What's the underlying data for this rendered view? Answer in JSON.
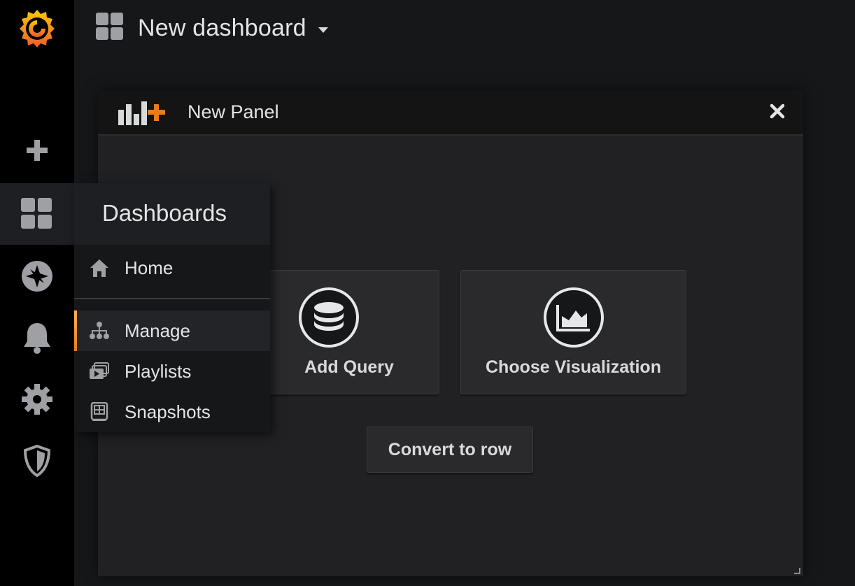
{
  "topbar": {
    "title": "New dashboard"
  },
  "panel": {
    "title": "New Panel",
    "actions": {
      "add_query_label": "Add Query",
      "choose_viz_label": "Choose Visualization",
      "convert_label": "Convert to row"
    }
  },
  "sidebar": {
    "items": [
      {
        "icon": "grafana-logo-icon"
      },
      {
        "icon": "plus-icon"
      },
      {
        "icon": "dashboards-grid-icon",
        "active": true
      },
      {
        "icon": "explore-compass-icon"
      },
      {
        "icon": "bell-icon"
      },
      {
        "icon": "gear-icon"
      },
      {
        "icon": "shield-icon"
      }
    ]
  },
  "dashboards_menu": {
    "header": "Dashboards",
    "items": [
      {
        "label": "Home",
        "icon": "home-icon"
      },
      {
        "label": "Manage",
        "icon": "sitemap-icon",
        "active": true
      },
      {
        "label": "Playlists",
        "icon": "playlist-icon"
      },
      {
        "label": "Snapshots",
        "icon": "snapshot-icon"
      }
    ]
  },
  "colors": {
    "accent_orange": "#eb7b18",
    "brand_yellow": "#ffb357",
    "background": "#161719",
    "sidebar": "#000000"
  }
}
